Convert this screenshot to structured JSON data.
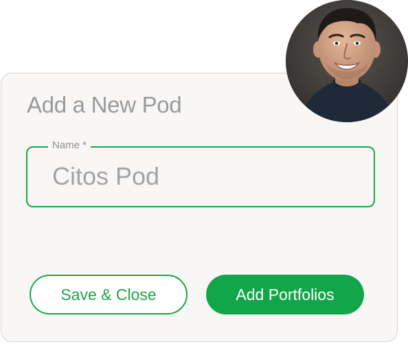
{
  "form": {
    "title": "Add a New Pod",
    "name_field": {
      "label": "Name *",
      "value": "Citos Pod"
    }
  },
  "actions": {
    "save_close_label": "Save & Close",
    "add_portfolios_label": "Add Portfolios"
  },
  "avatar": {
    "icon": "user-photo"
  },
  "colors": {
    "accent": "#12a64a",
    "card_background": "#f9f7f6",
    "muted_text": "#9a9a9a"
  }
}
